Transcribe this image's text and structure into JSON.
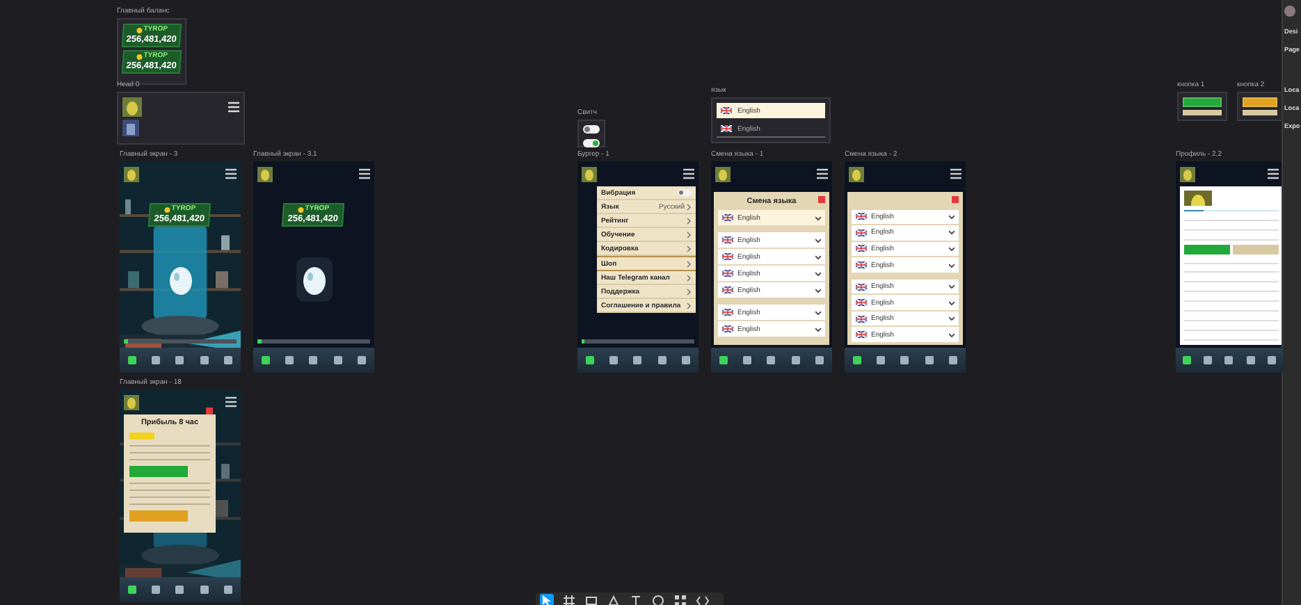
{
  "frames": [
    {
      "kind": "balance",
      "label": "Главный баланс",
      "cards": [
        {
          "currency": "TYROP",
          "amount": "256,481,420"
        },
        {
          "currency": "TYROP",
          "amount": "256,481,420"
        }
      ]
    },
    {
      "kind": "head",
      "label": "Head 0"
    },
    {
      "kind": "main",
      "label": "Главный экран - 3",
      "currency": "TYROP",
      "amount": "256,481,420",
      "progress": {
        "level": 0.04
      }
    },
    {
      "kind": "main_dark",
      "label": "Главный экран - 3.1",
      "currency": "TYROP",
      "amount": "256,481,420",
      "progress": {
        "level": 0.04
      }
    },
    {
      "kind": "switches",
      "label": "Свитч",
      "switches": [
        {
          "on": false
        },
        {
          "on": true
        }
      ]
    },
    {
      "kind": "burger",
      "label": "Бургер - 1",
      "menu": [
        {
          "label": "Вибрация",
          "kind": "toggle",
          "on": false
        },
        {
          "label": "Язык",
          "kind": "value",
          "value": "Русский"
        },
        {
          "label": "Рейтинг",
          "kind": "link"
        },
        {
          "label": "Обучение",
          "kind": "link"
        },
        {
          "label": "Кодировка",
          "kind": "link"
        },
        {
          "label": "Шоп",
          "kind": "link",
          "selected": true
        },
        {
          "label": "Наш Telegram канал",
          "kind": "link"
        },
        {
          "label": "Поддержка",
          "kind": "link"
        },
        {
          "label": "Соглашение и правила",
          "kind": "link"
        }
      ]
    },
    {
      "kind": "language",
      "label": "язык",
      "rows": [
        {
          "name": "English",
          "selected": true
        },
        {
          "name": "English",
          "selected": false
        }
      ]
    },
    {
      "kind": "language_modal",
      "label": "Смена языка - 1",
      "title": "Смена языка",
      "rows": [
        {
          "name": "English",
          "selected": true
        },
        {
          "name": "English",
          "selected": false
        },
        {
          "name": "English",
          "selected": false
        },
        {
          "name": "English",
          "selected": false
        },
        {
          "name": "English",
          "selected": false
        },
        {
          "name": "English",
          "selected": false
        },
        {
          "name": "English",
          "selected": false
        }
      ]
    },
    {
      "kind": "language_list",
      "label": "Смена языка - 2",
      "rows": [
        {
          "name": "English",
          "selected": false
        },
        {
          "name": "English",
          "selected": false
        },
        {
          "name": "English",
          "selected": false
        },
        {
          "name": "English",
          "selected": false
        },
        {
          "name": "English",
          "selected": false
        },
        {
          "name": "English",
          "selected": false
        },
        {
          "name": "English",
          "selected": false
        },
        {
          "name": "English",
          "selected": false
        }
      ]
    },
    {
      "kind": "buttons",
      "label": "кнопка 1"
    },
    {
      "kind": "buttons",
      "label": "кнопка 2"
    },
    {
      "kind": "profile",
      "label": "Профиль - 2.2"
    },
    {
      "kind": "popup",
      "label": "Главный экран - 18",
      "title": "Прибыль 8 час"
    }
  ],
  "inspector": {
    "items": [
      "Desi",
      "Page",
      "Loca",
      "Loca",
      "Expo"
    ]
  }
}
